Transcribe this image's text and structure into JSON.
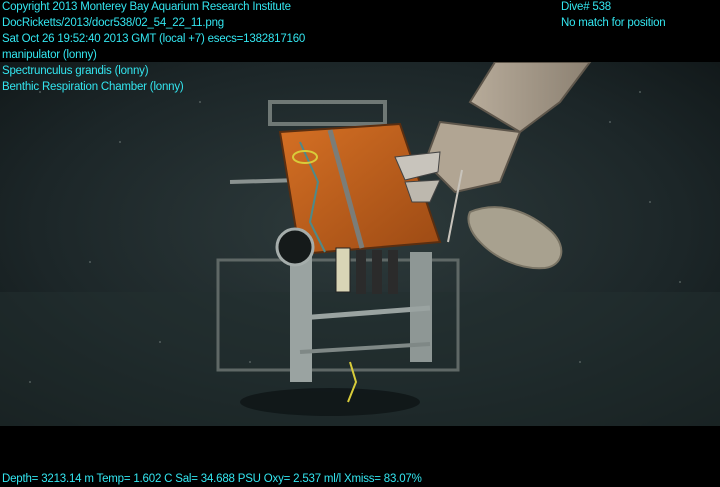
{
  "overlay": {
    "top_left": [
      "Copyright 2013 Monterey Bay Aquarium Research Institute",
      "DocRicketts/2013/docr538/02_54_22_11.png",
      "Sat Oct 26 19:52:40 2013 GMT (local +7)  esecs=1382817160",
      "manipulator (lonny)",
      "Spectrunculus grandis (lonny)",
      "Benthic Respiration Chamber (lonny)"
    ],
    "top_right": [
      "Dive# 538",
      "No match for position"
    ],
    "bottom": "Depth= 3213.14 m  Temp= 1.602 C  Sal= 34.688 PSU  Oxy= 2.537 ml/l  Xmiss= 83.07%"
  },
  "colors": {
    "overlay_text": "#33e6f0",
    "water": "#1f2a2c",
    "chamber_lid": "#c8641c"
  }
}
